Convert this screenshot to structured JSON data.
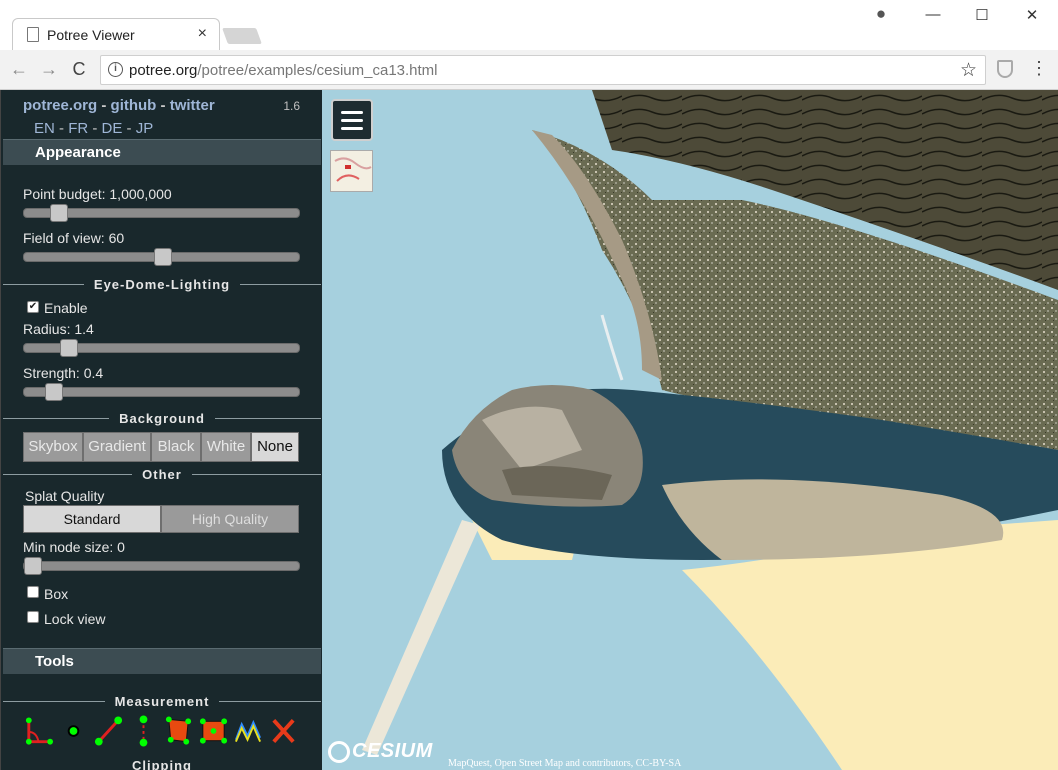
{
  "browser": {
    "tab_title": "Potree Viewer",
    "tab_close": "×",
    "url_host": "potree.org",
    "url_path": "/potree/examples/cesium_ca13.html",
    "back_icon": "←",
    "forward_icon": "→",
    "reload_icon": "C",
    "star_icon": "☆",
    "menu_icon": "⋮",
    "minimize": "—",
    "maximize": "☐",
    "close": "✕",
    "account_icon": "●"
  },
  "sidebar": {
    "link_potree": "potree.org",
    "link_github": "github",
    "link_twitter": "twitter",
    "link_sep": " - ",
    "version": "1.6",
    "langs": [
      "EN",
      "FR",
      "DE",
      "JP"
    ],
    "appearance": {
      "header": "Appearance",
      "point_budget_label": "Point budget: 1,000,000",
      "fov_label": "Field of view: 60",
      "point_budget_level": 0.1,
      "fov_level": 0.5
    },
    "edl": {
      "header": "Eye-Dome-Lighting",
      "enable_label": "Enable",
      "enable_checked": "✔",
      "radius_label": "Radius: 1.4",
      "strength_label": "Strength: 0.4",
      "radius_level": 0.14,
      "strength_level": 0.08
    },
    "background": {
      "header": "Background",
      "options": [
        "Skybox",
        "Gradient",
        "Black",
        "White",
        "None"
      ],
      "selected": "None"
    },
    "other": {
      "header": "Other",
      "splat_quality_label": "Splat Quality",
      "quality_options": [
        "Standard",
        "High Quality"
      ],
      "selected_quality": "Standard",
      "min_node_label": "Min node size: 0",
      "min_node_level": 0,
      "box_label": "Box",
      "lock_view_label": "Lock view"
    },
    "tools": {
      "header": "Tools",
      "measurement_header": "Measurement",
      "clipping_header": "Clipping",
      "tool_icons": [
        "angle-icon",
        "point-icon",
        "distance-icon",
        "height-icon",
        "area-icon",
        "volume-icon",
        "profile-icon",
        "remove-all-icon"
      ]
    }
  },
  "viewport": {
    "cesium_logo": "CESIUM",
    "attribution": "MapQuest, Open Street Map and contributors, CC-BY-SA"
  },
  "colors": {
    "sidebar_bg": "#19282c",
    "section_header_bg": "#3c4c52",
    "link_color": "#9fb6d6",
    "water": "#a6d0de",
    "sand": "#fbecb8"
  }
}
